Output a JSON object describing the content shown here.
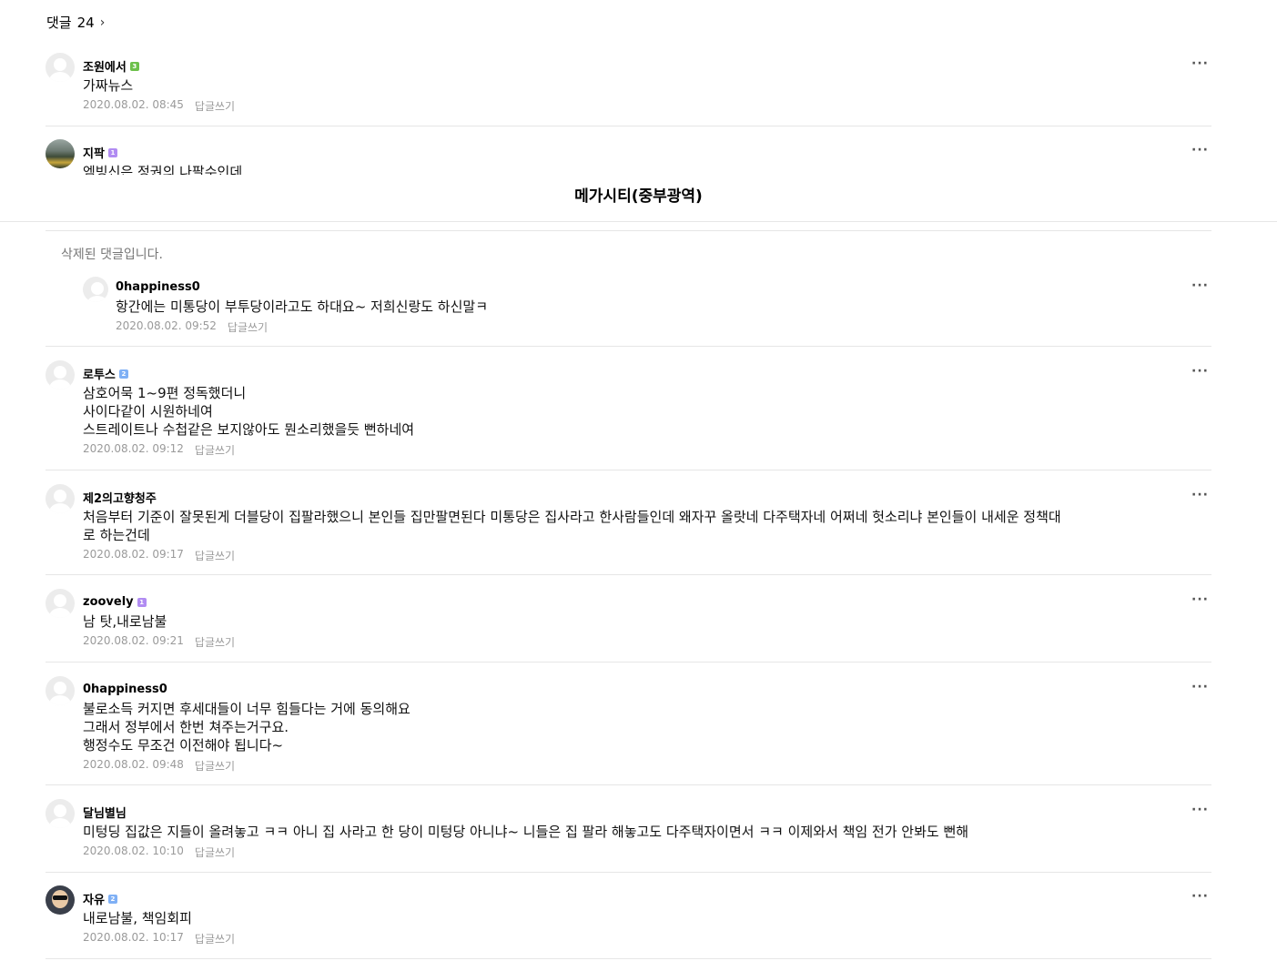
{
  "header": {
    "label": "댓글",
    "count": "24",
    "chevron": "›"
  },
  "sticky_title": "메가시티(중부광역)",
  "deleted_text": "삭제된 댓글입니다.",
  "reply_label": "답글쓰기",
  "more_label": "···",
  "comments": [
    {
      "author": "조원에서",
      "badge": "green",
      "text": "가짜뉴스",
      "date": "2020.08.02. 08:45"
    },
    {
      "author": "지팍",
      "badge": "purple",
      "text": "엠빙신은 정권의 나팔수인데",
      "date": ""
    },
    {
      "author": "0happiness0",
      "badge": "",
      "text": "항간에는 미통당이 부투당이라고도 하대요~ 저희신랑도 하신말ㅋ",
      "date": "2020.08.02. 09:52"
    },
    {
      "author": "로투스",
      "badge": "blue",
      "text": "삼호어묵 1~9편 정독했더니\n사이다같이 시원하네여\n스트레이트나 수첩같은 보지않아도 뭔소리했을듯 뻔하네여",
      "date": "2020.08.02. 09:12"
    },
    {
      "author": "제2의고향청주",
      "badge": "",
      "text": "처음부터 기준이 잘못된게 더블당이 집팔라했으니 본인들 집만팔면된다 미통당은 집사라고 한사람들인데 왜자꾸 올랏네 다주택자네 어쩌네 헛소리냐 본인들이 내세운 정책대\n로 하는건데",
      "date": "2020.08.02. 09:17"
    },
    {
      "author": "zoovely",
      "badge": "purple",
      "text": "남 탓,내로남불",
      "date": "2020.08.02. 09:21"
    },
    {
      "author": "0happiness0",
      "badge": "",
      "text": "불로소득 커지면 후세대들이 너무 힘들다는 거에 동의해요\n그래서 정부에서 한번 쳐주는거구요.\n행정수도 무조건 이전해야 됩니다~",
      "date": "2020.08.02. 09:48"
    },
    {
      "author": "달님별님",
      "badge": "",
      "text": "미텅딩 집값은 지들이 올려놓고 ㅋㅋ 아니 집 사라고 한 당이 미텅당 아니냐~ 니들은 집 팔라 해놓고도 다주택자이면서 ㅋㅋ 이제와서 책임 전가 안봐도 뻔해",
      "date": "2020.08.02. 10:10"
    },
    {
      "author": "자유",
      "badge": "blue",
      "text": "내로남불, 책임회피",
      "date": "2020.08.02. 10:17"
    }
  ]
}
